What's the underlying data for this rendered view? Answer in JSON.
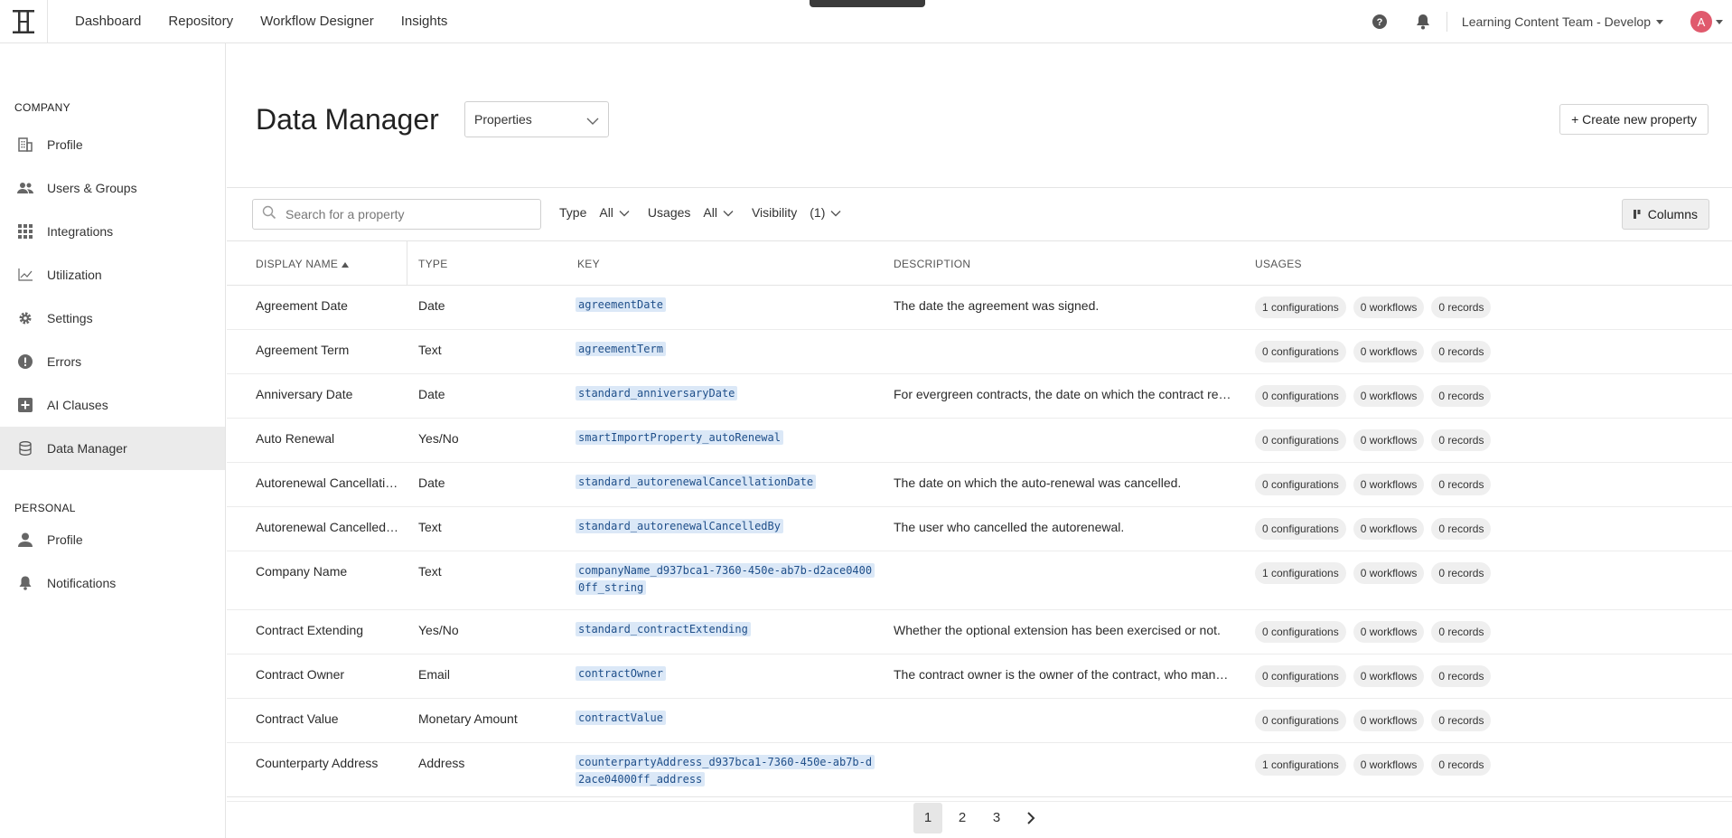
{
  "topbar": {
    "nav": [
      "Dashboard",
      "Repository",
      "Workflow Designer",
      "Insights"
    ],
    "team": "Learning Content Team - Develop",
    "avatar_initial": "A"
  },
  "sidebar": {
    "company_label": "COMPANY",
    "company_items": [
      {
        "label": "Profile",
        "icon": "building-icon"
      },
      {
        "label": "Users & Groups",
        "icon": "users-icon"
      },
      {
        "label": "Integrations",
        "icon": "grid-icon"
      },
      {
        "label": "Utilization",
        "icon": "chart-icon"
      },
      {
        "label": "Settings",
        "icon": "gear-icon"
      },
      {
        "label": "Errors",
        "icon": "alert-icon"
      },
      {
        "label": "AI Clauses",
        "icon": "plus-box-icon"
      },
      {
        "label": "Data Manager",
        "icon": "database-icon",
        "active": true
      }
    ],
    "personal_label": "PERSONAL",
    "personal_items": [
      {
        "label": "Profile",
        "icon": "person-icon"
      },
      {
        "label": "Notifications",
        "icon": "bell-icon"
      }
    ]
  },
  "main": {
    "title": "Data Manager",
    "select_value": "Properties",
    "create_button": "+ Create new property",
    "search_placeholder": "Search for a property",
    "filters": {
      "type_label": "Type",
      "type_value": "All",
      "usages_label": "Usages",
      "usages_value": "All",
      "visibility_label": "Visibility",
      "visibility_value": "(1)"
    },
    "columns_button": "Columns"
  },
  "table": {
    "headers": [
      "DISPLAY NAME",
      "TYPE",
      "KEY",
      "DESCRIPTION",
      "USAGES"
    ],
    "rows": [
      {
        "name": "Agreement Date",
        "type": "Date",
        "key": "agreementDate",
        "desc": "The date the agreement was signed.",
        "configs": "1 configurations",
        "workflows": "0 workflows",
        "records": "0 records"
      },
      {
        "name": "Agreement Term",
        "type": "Text",
        "key": "agreementTerm",
        "desc": "",
        "configs": "0 configurations",
        "workflows": "0 workflows",
        "records": "0 records"
      },
      {
        "name": "Anniversary Date",
        "type": "Date",
        "key": "standard_anniversaryDate",
        "desc": "For evergreen contracts, the date on which the contract renews.",
        "configs": "0 configurations",
        "workflows": "0 workflows",
        "records": "0 records"
      },
      {
        "name": "Auto Renewal",
        "type": "Yes/No",
        "key": "smartImportProperty_autoRenewal",
        "desc": "",
        "configs": "0 configurations",
        "workflows": "0 workflows",
        "records": "0 records"
      },
      {
        "name": "Autorenewal Cancellation Date",
        "type": "Date",
        "key": "standard_autorenewalCancellationDate",
        "desc": "The date on which the auto-renewal was cancelled.",
        "configs": "0 configurations",
        "workflows": "0 workflows",
        "records": "0 records"
      },
      {
        "name": "Autorenewal Cancelled By",
        "type": "Text",
        "key": "standard_autorenewalCancelledBy",
        "desc": "The user who cancelled the autorenewal.",
        "configs": "0 configurations",
        "workflows": "0 workflows",
        "records": "0 records"
      },
      {
        "name": "Company Name",
        "type": "Text",
        "key": "companyName_d937bca1-7360-450e-ab7b-d2ace04000ff_string",
        "desc": "",
        "configs": "1 configurations",
        "workflows": "0 workflows",
        "records": "0 records"
      },
      {
        "name": "Contract Extending",
        "type": "Yes/No",
        "key": "standard_contractExtending",
        "desc": "Whether the optional extension has been exercised or not.",
        "configs": "0 configurations",
        "workflows": "0 workflows",
        "records": "0 records"
      },
      {
        "name": "Contract Owner",
        "type": "Email",
        "key": "contractOwner",
        "desc": "The contract owner is the owner of the contract, who manages it.",
        "configs": "0 configurations",
        "workflows": "0 workflows",
        "records": "0 records"
      },
      {
        "name": "Contract Value",
        "type": "Monetary Amount",
        "key": "contractValue",
        "desc": "",
        "configs": "0 configurations",
        "workflows": "0 workflows",
        "records": "0 records"
      },
      {
        "name": "Counterparty Address",
        "type": "Address",
        "key": "counterpartyAddress_d937bca1-7360-450e-ab7b-d2ace04000ff_address",
        "desc": "",
        "configs": "1 configurations",
        "workflows": "0 workflows",
        "records": "0 records"
      }
    ]
  },
  "pagination": {
    "pages": [
      "1",
      "2",
      "3"
    ],
    "current": "1"
  }
}
